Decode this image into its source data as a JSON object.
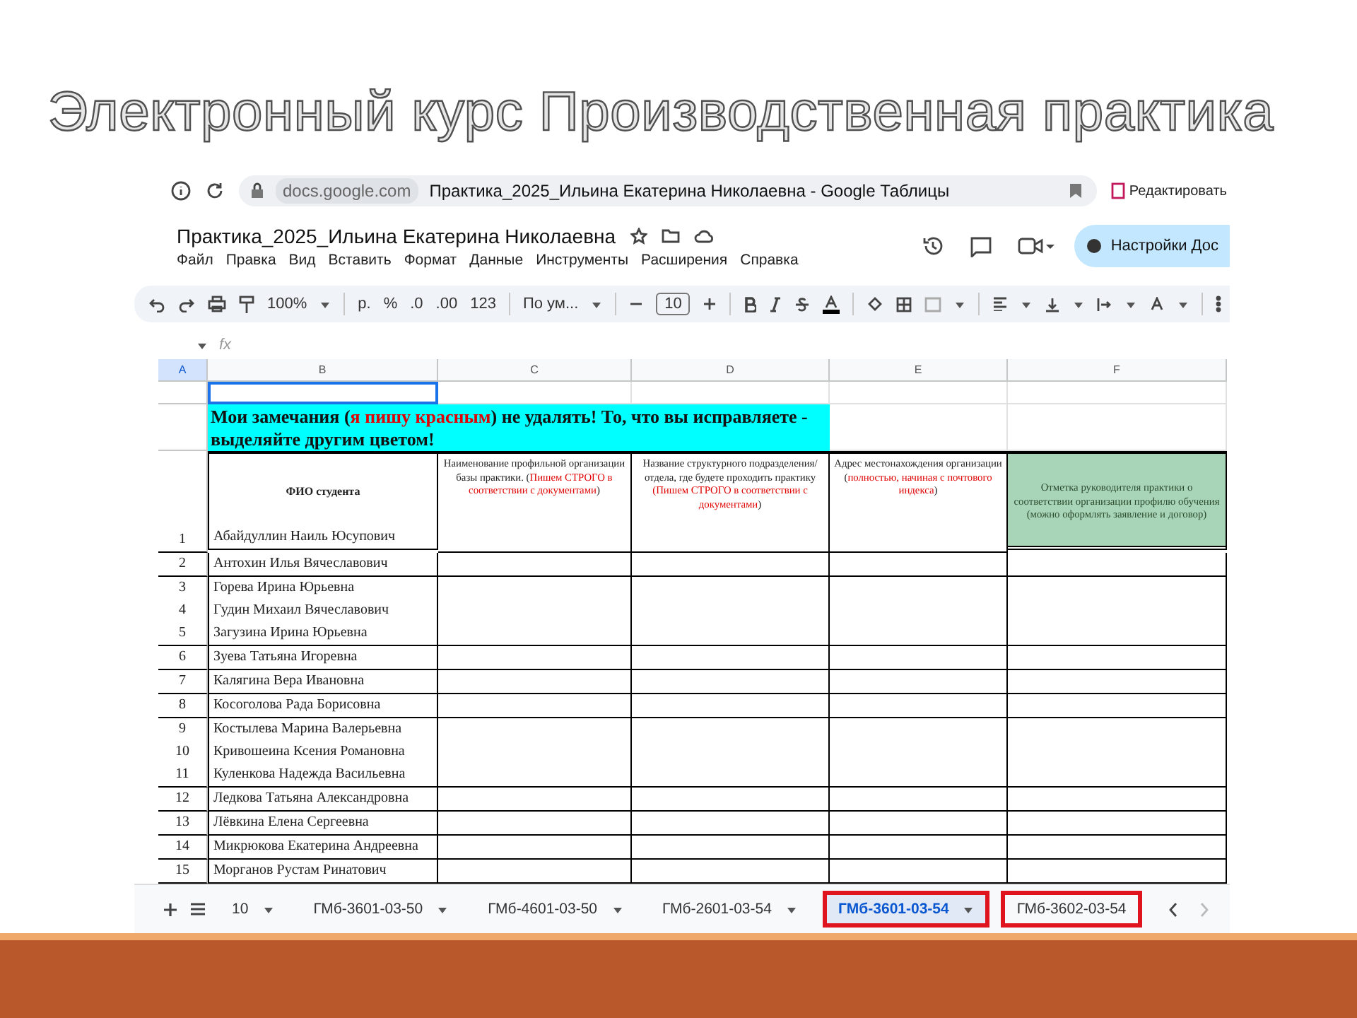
{
  "slide_title": "Электронный курс Производственная практика",
  "browser": {
    "address": "docs.google.com",
    "page_title": "Практика_2025_Ильина Екатерина Николаевна - Google Таблицы",
    "edit_label": "Редактировать"
  },
  "document": {
    "title": "Практика_2025_Ильина Екатерина Николаевна",
    "share_label": "Настройки Дос",
    "menu": [
      "Файл",
      "Правка",
      "Вид",
      "Вставить",
      "Формат",
      "Данные",
      "Инструменты",
      "Расширения",
      "Справка"
    ]
  },
  "toolbar": {
    "zoom": "100%",
    "currency": "р.",
    "percent": "%",
    "decrease_decimal": ".0",
    "increase_decimal": ".00",
    "number_format": "123",
    "font": "По ум...",
    "font_size": "10"
  },
  "formula_bar": {
    "fx": "fx"
  },
  "columns": [
    "A",
    "B",
    "C",
    "D",
    "E",
    "F"
  ],
  "notice": [
    {
      "text": "Мои замечания (",
      "emphasis": false
    },
    {
      "text": "я пишу красным",
      "emphasis": true
    },
    {
      "text": ") не удалять! То, что вы исправляете - выделяйте другим цветом!",
      "emphasis": false
    }
  ],
  "header": {
    "row_number": "1",
    "student_title": "ФИО студента",
    "first_student": "Абайдуллин Наиль Юсупович",
    "cells": [
      {
        "kind": "plain",
        "parts": [
          {
            "text": "Наименование профильной организации  базы практики. (",
            "emphasis": false
          },
          {
            "text": "Пишем СТРОГО  в соответствии с документами",
            "emphasis": true
          },
          {
            "text": ")",
            "emphasis": false
          }
        ]
      },
      {
        "kind": "plain",
        "parts": [
          {
            "text": "Название структурного подразделения/отдела, где будете проходить практику  ",
            "emphasis": false
          },
          {
            "text": "(Пишем СТРОГО  в соответствии с документами",
            "emphasis": true
          },
          {
            "text": ")",
            "emphasis": false
          }
        ]
      },
      {
        "kind": "plain",
        "parts": [
          {
            "text": "Адрес местонахождения организации (",
            "emphasis": false
          },
          {
            "text": "полностью, начиная с почтового индекса",
            "emphasis": true
          },
          {
            "text": ")",
            "emphasis": false
          }
        ]
      },
      {
        "kind": "shaded",
        "parts": [
          {
            "text": "Отметка руководителя практики о соответствии организации профилю обучения (можно оформлять заявление и договор)",
            "emphasis": false
          }
        ]
      }
    ]
  },
  "row_groups": [
    {
      "students": [
        {
          "number": "2",
          "name": "Антохин Илья Вячеславович"
        }
      ]
    },
    {
      "students": [
        {
          "number": "3",
          "name": "Горева Ирина Юрьевна"
        },
        {
          "number": "4",
          "name": "Гудин Михаил Вячеславович"
        },
        {
          "number": "5",
          "name": "Загузина Ирина Юрьевна"
        }
      ]
    },
    {
      "students": [
        {
          "number": "6",
          "name": "Зуева Татьяна Игоревна"
        }
      ]
    },
    {
      "students": [
        {
          "number": "7",
          "name": "Калягина Вера Ивановна"
        }
      ]
    },
    {
      "students": [
        {
          "number": "8",
          "name": "Косоголова Рада Борисовна"
        }
      ]
    },
    {
      "students": [
        {
          "number": "9",
          "name": "Костылева Марина Валерьевна"
        },
        {
          "number": "10",
          "name": "Кривошеина Ксения Романовна"
        },
        {
          "number": "11",
          "name": "Куленкова Надежда Васильевна"
        }
      ]
    },
    {
      "students": [
        {
          "number": "12",
          "name": "Ледкова Татьяна Александровна"
        }
      ]
    },
    {
      "students": [
        {
          "number": "13",
          "name": "Лёвкина Елена Сергеевна"
        }
      ]
    },
    {
      "students": [
        {
          "number": "14",
          "name": "Микрюкова Екатерина Андреевна"
        }
      ]
    },
    {
      "students": [
        {
          "number": "15",
          "name": "Морганов Рустам Ринатович"
        }
      ]
    }
  ],
  "sheet_tabs": [
    {
      "label": "10",
      "selected": false,
      "highlighted": false,
      "menu": true
    },
    {
      "label": "ГМб-3601-03-50",
      "selected": false,
      "highlighted": false,
      "menu": true
    },
    {
      "label": "ГМб-4601-03-50",
      "selected": false,
      "highlighted": false,
      "menu": true
    },
    {
      "label": "ГМб-2601-03-54",
      "selected": false,
      "highlighted": false,
      "menu": true
    },
    {
      "label": "ГМб-3601-03-54",
      "selected": true,
      "highlighted": true,
      "menu": true
    },
    {
      "label": "ГМб-3602-03-54",
      "selected": false,
      "highlighted": true,
      "menu": false
    }
  ]
}
